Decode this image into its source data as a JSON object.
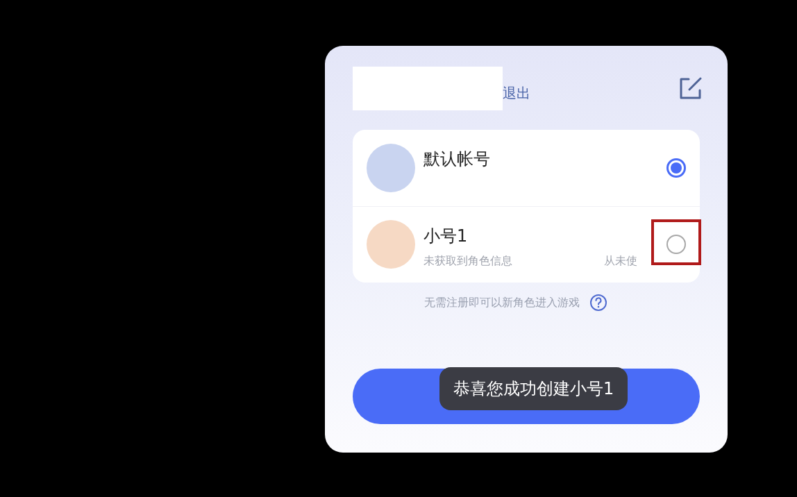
{
  "header": {
    "logout": "退出"
  },
  "accounts": [
    {
      "name": "默认帐号",
      "selected": true,
      "color": "#c9d4f0"
    },
    {
      "name": "小号1",
      "subtitle": "未获取到角色信息",
      "last_used": "从未使",
      "selected": false,
      "color": "#f6d9c4"
    }
  ],
  "hint": "无需注册即可以新角色进入游戏",
  "toast": "恭喜您成功创建小号1"
}
